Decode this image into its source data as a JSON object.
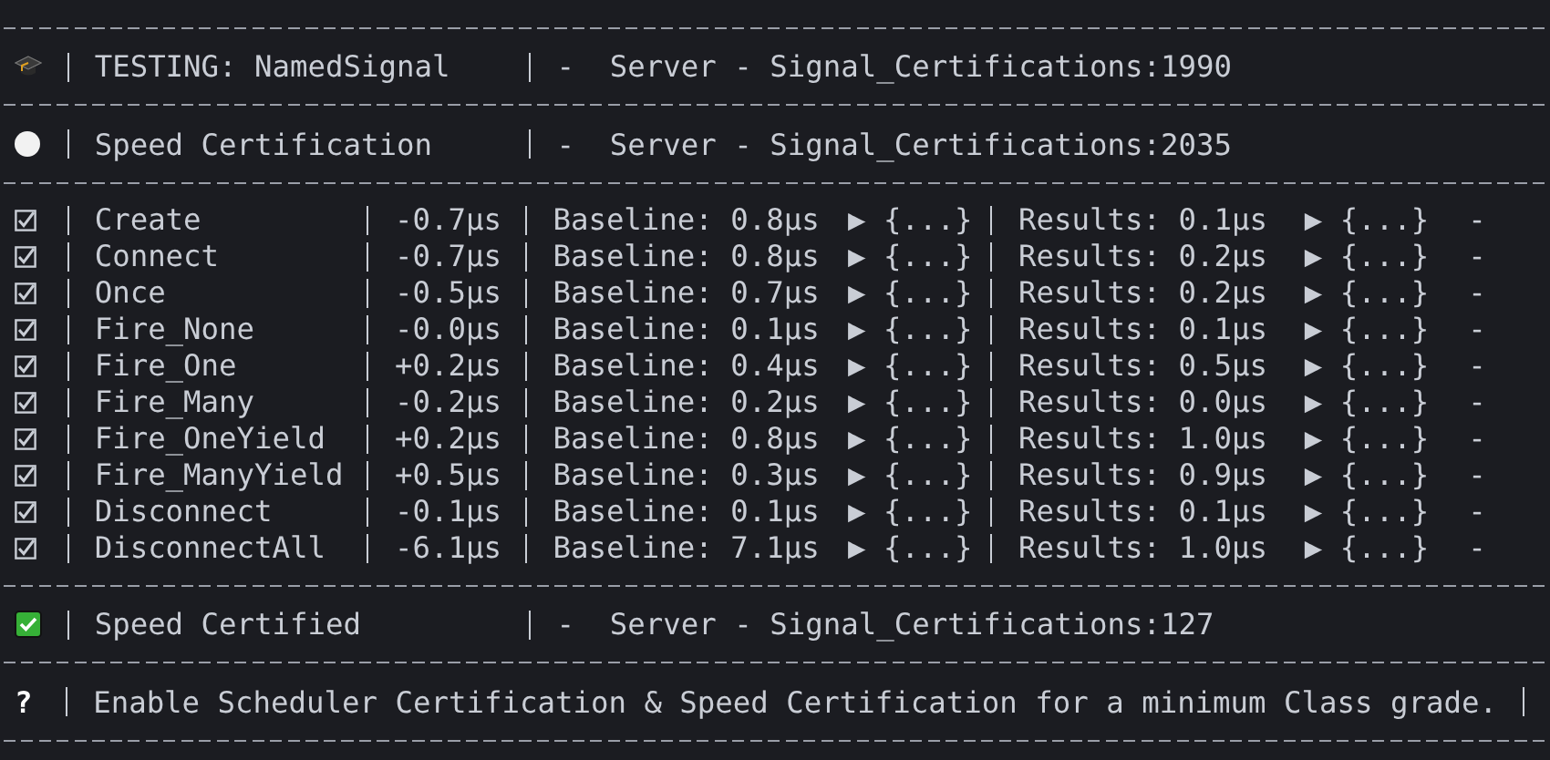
{
  "sections": [
    {
      "kind": "suite",
      "title": "TESTING: NamedSignal",
      "source": "-  Server - Signal_Certifications:1990"
    },
    {
      "kind": "running",
      "title": "Speed Certification",
      "source": "-  Server - Signal_Certifications:2035"
    },
    {
      "kind": "tests",
      "rows": [
        {
          "checked": true,
          "name": "Create",
          "delta": "-0.7μs",
          "baseline": "Baseline: 0.8μs",
          "baseline_details": "▶ {...}",
          "results": "Results: 0.1μs",
          "results_details": "▶ {...}",
          "trailing": "-"
        },
        {
          "checked": true,
          "name": "Connect",
          "delta": "-0.7μs",
          "baseline": "Baseline: 0.8μs",
          "baseline_details": "▶ {...}",
          "results": "Results: 0.2μs",
          "results_details": "▶ {...}",
          "trailing": "-"
        },
        {
          "checked": true,
          "name": "Once",
          "delta": "-0.5μs",
          "baseline": "Baseline: 0.7μs",
          "baseline_details": "▶ {...}",
          "results": "Results: 0.2μs",
          "results_details": "▶ {...}",
          "trailing": "-"
        },
        {
          "checked": true,
          "name": "Fire_None",
          "delta": "-0.0μs",
          "baseline": "Baseline: 0.1μs",
          "baseline_details": "▶ {...}",
          "results": "Results: 0.1μs",
          "results_details": "▶ {...}",
          "trailing": "-"
        },
        {
          "checked": true,
          "name": "Fire_One",
          "delta": "+0.2μs",
          "baseline": "Baseline: 0.4μs",
          "baseline_details": "▶ {...}",
          "results": "Results: 0.5μs",
          "results_details": "▶ {...}",
          "trailing": "-"
        },
        {
          "checked": true,
          "name": "Fire_Many",
          "delta": "-0.2μs",
          "baseline": "Baseline: 0.2μs",
          "baseline_details": "▶ {...}",
          "results": "Results: 0.0μs",
          "results_details": "▶ {...}",
          "trailing": "-"
        },
        {
          "checked": true,
          "name": "Fire_OneYield",
          "delta": "+0.2μs",
          "baseline": "Baseline: 0.8μs",
          "baseline_details": "▶ {...}",
          "results": "Results: 1.0μs",
          "results_details": "▶ {...}",
          "trailing": "-"
        },
        {
          "checked": true,
          "name": "Fire_ManyYield",
          "delta": "+0.5μs",
          "baseline": "Baseline: 0.3μs",
          "baseline_details": "▶ {...}",
          "results": "Results: 0.9μs",
          "results_details": "▶ {...}",
          "trailing": "-"
        },
        {
          "checked": true,
          "name": "Disconnect",
          "delta": "-0.1μs",
          "baseline": "Baseline: 0.1μs",
          "baseline_details": "▶ {...}",
          "results": "Results: 0.1μs",
          "results_details": "▶ {...}",
          "trailing": "-"
        },
        {
          "checked": true,
          "name": "DisconnectAll",
          "delta": "-6.1μs",
          "baseline": "Baseline: 7.1μs",
          "baseline_details": "▶ {...}",
          "results": "Results: 1.0μs",
          "results_details": "▶ {...}",
          "trailing": "-"
        }
      ]
    },
    {
      "kind": "certified",
      "title": "Speed Certified",
      "source": "-  Server - Signal_Certifications:127"
    },
    {
      "kind": "note",
      "marker": "?",
      "text": "Enable Scheduler Certification & Speed Certification for a minimum Class grade."
    }
  ]
}
